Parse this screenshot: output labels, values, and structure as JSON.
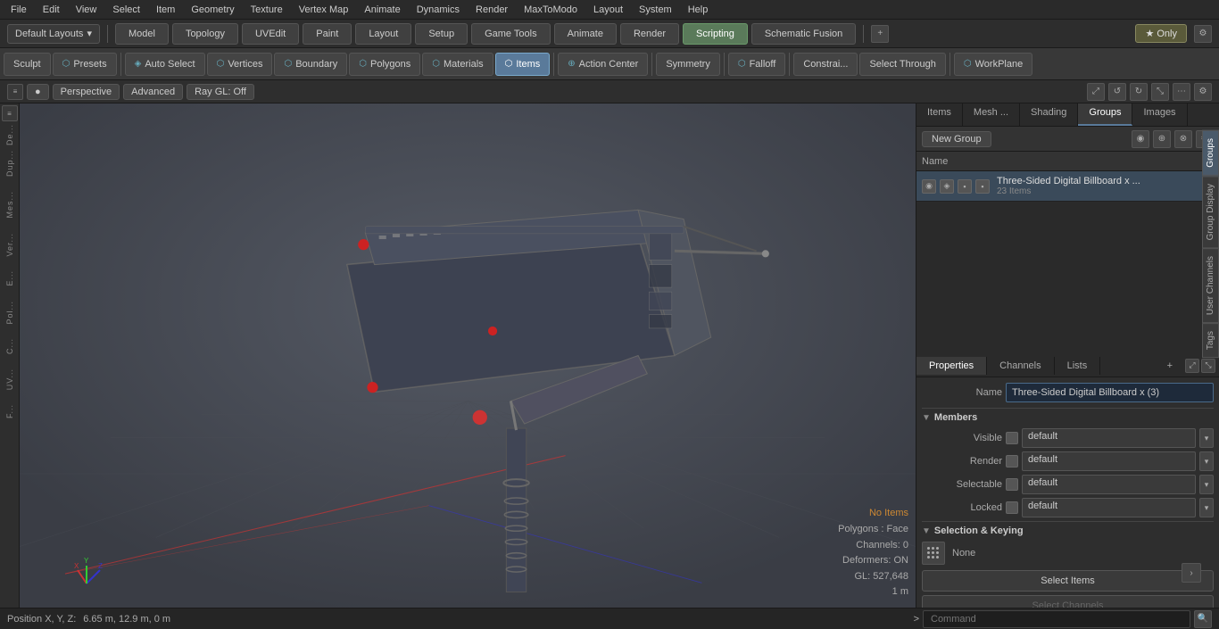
{
  "menubar": {
    "items": [
      "File",
      "Edit",
      "View",
      "Select",
      "Item",
      "Geometry",
      "Texture",
      "Vertex Map",
      "Animate",
      "Dynamics",
      "Render",
      "MaxToModo",
      "Layout",
      "System",
      "Help"
    ]
  },
  "layoutbar": {
    "dropdown": "Default Layouts",
    "tabs": [
      "Model",
      "Topology",
      "UVEdit",
      "Paint",
      "Layout",
      "Setup",
      "Game Tools",
      "Animate",
      "Render",
      "Scripting",
      "Schematic Fusion"
    ],
    "active_tab": "Scripting",
    "only_label": "★ Only",
    "plus_icon": "+"
  },
  "toolbar": {
    "sculpt_label": "Sculpt",
    "presets_label": "Presets",
    "auto_select_label": "Auto Select",
    "vertices_label": "Vertices",
    "boundary_label": "Boundary",
    "polygons_label": "Polygons",
    "materials_label": "Materials",
    "items_label": "Items",
    "action_center_label": "Action Center",
    "symmetry_label": "Symmetry",
    "falloff_label": "Falloff",
    "constrain_label": "Constrai...",
    "select_through_label": "Select Through",
    "workplane_label": "WorkPlane"
  },
  "viewport": {
    "name": "Perspective",
    "mode": "Advanced",
    "ray_gl": "Ray GL: Off"
  },
  "status": {
    "no_items": "No Items",
    "polygons": "Polygons : Face",
    "channels": "Channels: 0",
    "deformers": "Deformers: ON",
    "gl": "GL: 527,648",
    "scale": "1 m"
  },
  "position": {
    "label": "Position X, Y, Z:",
    "value": "6.65 m, 12.9 m, 0 m"
  },
  "right_panel": {
    "group_tabs": [
      "Items",
      "Mesh ...",
      "Shading",
      "Groups",
      "Images"
    ],
    "active_group_tab": "Groups",
    "new_group_label": "New Group",
    "list_header": "Name",
    "group_item": {
      "name": "Three-Sided Digital Billboard x ...",
      "sub": "23 Items"
    },
    "side_tabs": [
      "Groups",
      "Group Display",
      "User Channels",
      "Tags"
    ]
  },
  "properties": {
    "tabs": [
      "Properties",
      "Channels",
      "Lists"
    ],
    "active_tab": "Properties",
    "plus_icon": "+",
    "name_label": "Name",
    "name_value": "Three-Sided Digital Billboard x (3)",
    "members_label": "Members",
    "visible_label": "Visible",
    "visible_value": "default",
    "render_label": "Render",
    "render_value": "default",
    "selectable_label": "Selectable",
    "selectable_value": "default",
    "locked_label": "Locked",
    "locked_value": "default",
    "selection_keying_label": "Selection & Keying",
    "none_label": "None",
    "select_items_label": "Select Items",
    "select_channels_label": "Select Channels"
  },
  "bottom": {
    "position_label": "Position X, Y, Z:",
    "position_value": "6.65 m, 12.9 m, 0 m",
    "arrow": ">",
    "command_placeholder": "Command"
  }
}
